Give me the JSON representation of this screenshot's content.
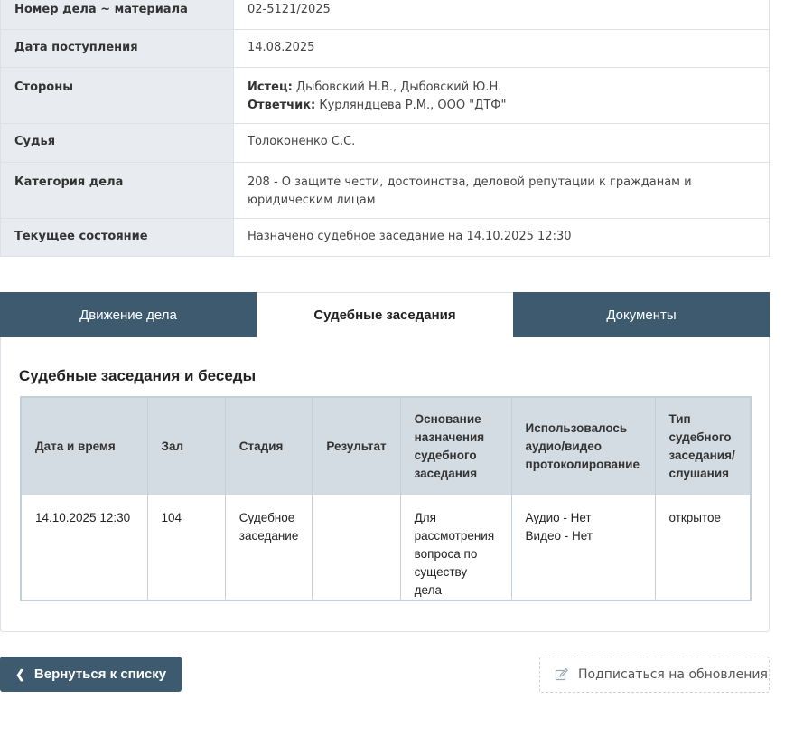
{
  "case_info": {
    "rows": [
      {
        "label": "Номер дела ~ материала",
        "value": "02-5121/2025"
      },
      {
        "label": "Дата поступления",
        "value": "14.08.2025"
      },
      {
        "label": "Стороны",
        "parties": [
          {
            "role": "Истец:",
            "names": " Дыбовский Н.В., Дыбовский Ю.Н."
          },
          {
            "role": "Ответчик:",
            "names": " Курляндцева Р.М., ООО \"ДТФ\""
          }
        ]
      },
      {
        "label": "Судья",
        "value": "Толоконенко С.С."
      },
      {
        "label": "Категория дела",
        "value": "208 - О защите чести, достоинства, деловой репутации к гражданам и юридическим лицам"
      },
      {
        "label": "Текущее состояние",
        "value": "Назначено судебное заседание на 14.10.2025 12:30"
      }
    ]
  },
  "tabs": [
    {
      "label": "Движение дела",
      "active": false
    },
    {
      "label": "Судебные заседания",
      "active": true
    },
    {
      "label": "Документы",
      "active": false
    }
  ],
  "hearings": {
    "title": "Судебные заседания и беседы",
    "columns": [
      "Дата и время",
      "Зал",
      "Стадия",
      "Результат",
      "Основание назначения судебного заседания",
      "Использовалось аудио/видео протоколирование",
      "Тип судебного заседания/ слушания"
    ],
    "rows": [
      {
        "datetime": "14.10.2025 12:30",
        "room": "104",
        "stage": "Судебное заседание",
        "result": "",
        "reason": "Для рассмотрения вопроса по существу дела",
        "av_audio": "Аудио - Нет",
        "av_video": "Видео - Нет",
        "type": "открытое"
      }
    ]
  },
  "buttons": {
    "back_label": "Вернуться к списку",
    "back_icon": "chevron-left-icon",
    "subscribe_label": "Подписаться на обновления",
    "subscribe_icon": "edit-icon"
  },
  "colors": {
    "accent": "#3d5a6e",
    "label_bg": "#e8ecf1",
    "table_header_bg": "#d3dce3"
  }
}
